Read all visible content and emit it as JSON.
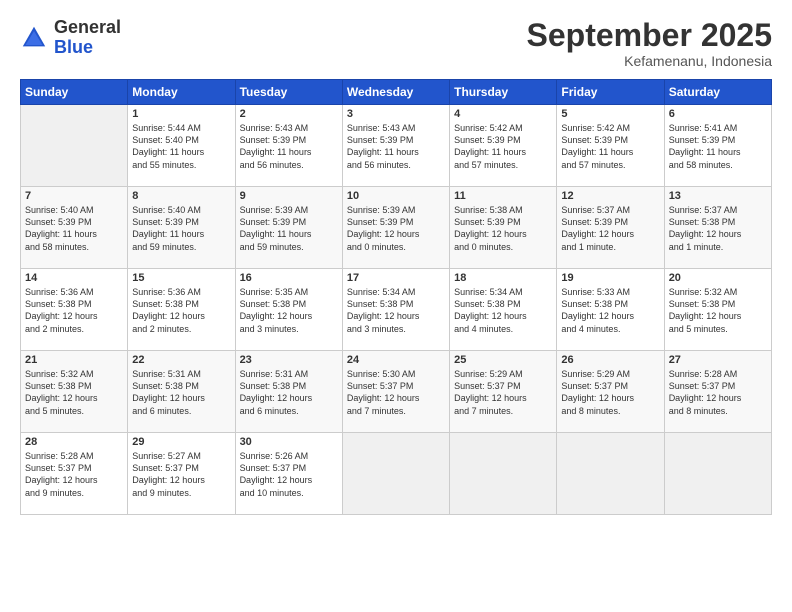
{
  "header": {
    "logo_general": "General",
    "logo_blue": "Blue",
    "month": "September 2025",
    "location": "Kefamenanu, Indonesia"
  },
  "days_of_week": [
    "Sunday",
    "Monday",
    "Tuesday",
    "Wednesday",
    "Thursday",
    "Friday",
    "Saturday"
  ],
  "weeks": [
    [
      {
        "day": "",
        "info": ""
      },
      {
        "day": "1",
        "info": "Sunrise: 5:44 AM\nSunset: 5:40 PM\nDaylight: 11 hours\nand 55 minutes."
      },
      {
        "day": "2",
        "info": "Sunrise: 5:43 AM\nSunset: 5:39 PM\nDaylight: 11 hours\nand 56 minutes."
      },
      {
        "day": "3",
        "info": "Sunrise: 5:43 AM\nSunset: 5:39 PM\nDaylight: 11 hours\nand 56 minutes."
      },
      {
        "day": "4",
        "info": "Sunrise: 5:42 AM\nSunset: 5:39 PM\nDaylight: 11 hours\nand 57 minutes."
      },
      {
        "day": "5",
        "info": "Sunrise: 5:42 AM\nSunset: 5:39 PM\nDaylight: 11 hours\nand 57 minutes."
      },
      {
        "day": "6",
        "info": "Sunrise: 5:41 AM\nSunset: 5:39 PM\nDaylight: 11 hours\nand 58 minutes."
      }
    ],
    [
      {
        "day": "7",
        "info": "Sunrise: 5:40 AM\nSunset: 5:39 PM\nDaylight: 11 hours\nand 58 minutes."
      },
      {
        "day": "8",
        "info": "Sunrise: 5:40 AM\nSunset: 5:39 PM\nDaylight: 11 hours\nand 59 minutes."
      },
      {
        "day": "9",
        "info": "Sunrise: 5:39 AM\nSunset: 5:39 PM\nDaylight: 11 hours\nand 59 minutes."
      },
      {
        "day": "10",
        "info": "Sunrise: 5:39 AM\nSunset: 5:39 PM\nDaylight: 12 hours\nand 0 minutes."
      },
      {
        "day": "11",
        "info": "Sunrise: 5:38 AM\nSunset: 5:39 PM\nDaylight: 12 hours\nand 0 minutes."
      },
      {
        "day": "12",
        "info": "Sunrise: 5:37 AM\nSunset: 5:39 PM\nDaylight: 12 hours\nand 1 minute."
      },
      {
        "day": "13",
        "info": "Sunrise: 5:37 AM\nSunset: 5:38 PM\nDaylight: 12 hours\nand 1 minute."
      }
    ],
    [
      {
        "day": "14",
        "info": "Sunrise: 5:36 AM\nSunset: 5:38 PM\nDaylight: 12 hours\nand 2 minutes."
      },
      {
        "day": "15",
        "info": "Sunrise: 5:36 AM\nSunset: 5:38 PM\nDaylight: 12 hours\nand 2 minutes."
      },
      {
        "day": "16",
        "info": "Sunrise: 5:35 AM\nSunset: 5:38 PM\nDaylight: 12 hours\nand 3 minutes."
      },
      {
        "day": "17",
        "info": "Sunrise: 5:34 AM\nSunset: 5:38 PM\nDaylight: 12 hours\nand 3 minutes."
      },
      {
        "day": "18",
        "info": "Sunrise: 5:34 AM\nSunset: 5:38 PM\nDaylight: 12 hours\nand 4 minutes."
      },
      {
        "day": "19",
        "info": "Sunrise: 5:33 AM\nSunset: 5:38 PM\nDaylight: 12 hours\nand 4 minutes."
      },
      {
        "day": "20",
        "info": "Sunrise: 5:32 AM\nSunset: 5:38 PM\nDaylight: 12 hours\nand 5 minutes."
      }
    ],
    [
      {
        "day": "21",
        "info": "Sunrise: 5:32 AM\nSunset: 5:38 PM\nDaylight: 12 hours\nand 5 minutes."
      },
      {
        "day": "22",
        "info": "Sunrise: 5:31 AM\nSunset: 5:38 PM\nDaylight: 12 hours\nand 6 minutes."
      },
      {
        "day": "23",
        "info": "Sunrise: 5:31 AM\nSunset: 5:38 PM\nDaylight: 12 hours\nand 6 minutes."
      },
      {
        "day": "24",
        "info": "Sunrise: 5:30 AM\nSunset: 5:37 PM\nDaylight: 12 hours\nand 7 minutes."
      },
      {
        "day": "25",
        "info": "Sunrise: 5:29 AM\nSunset: 5:37 PM\nDaylight: 12 hours\nand 7 minutes."
      },
      {
        "day": "26",
        "info": "Sunrise: 5:29 AM\nSunset: 5:37 PM\nDaylight: 12 hours\nand 8 minutes."
      },
      {
        "day": "27",
        "info": "Sunrise: 5:28 AM\nSunset: 5:37 PM\nDaylight: 12 hours\nand 8 minutes."
      }
    ],
    [
      {
        "day": "28",
        "info": "Sunrise: 5:28 AM\nSunset: 5:37 PM\nDaylight: 12 hours\nand 9 minutes."
      },
      {
        "day": "29",
        "info": "Sunrise: 5:27 AM\nSunset: 5:37 PM\nDaylight: 12 hours\nand 9 minutes."
      },
      {
        "day": "30",
        "info": "Sunrise: 5:26 AM\nSunset: 5:37 PM\nDaylight: 12 hours\nand 10 minutes."
      },
      {
        "day": "",
        "info": ""
      },
      {
        "day": "",
        "info": ""
      },
      {
        "day": "",
        "info": ""
      },
      {
        "day": "",
        "info": ""
      }
    ]
  ]
}
